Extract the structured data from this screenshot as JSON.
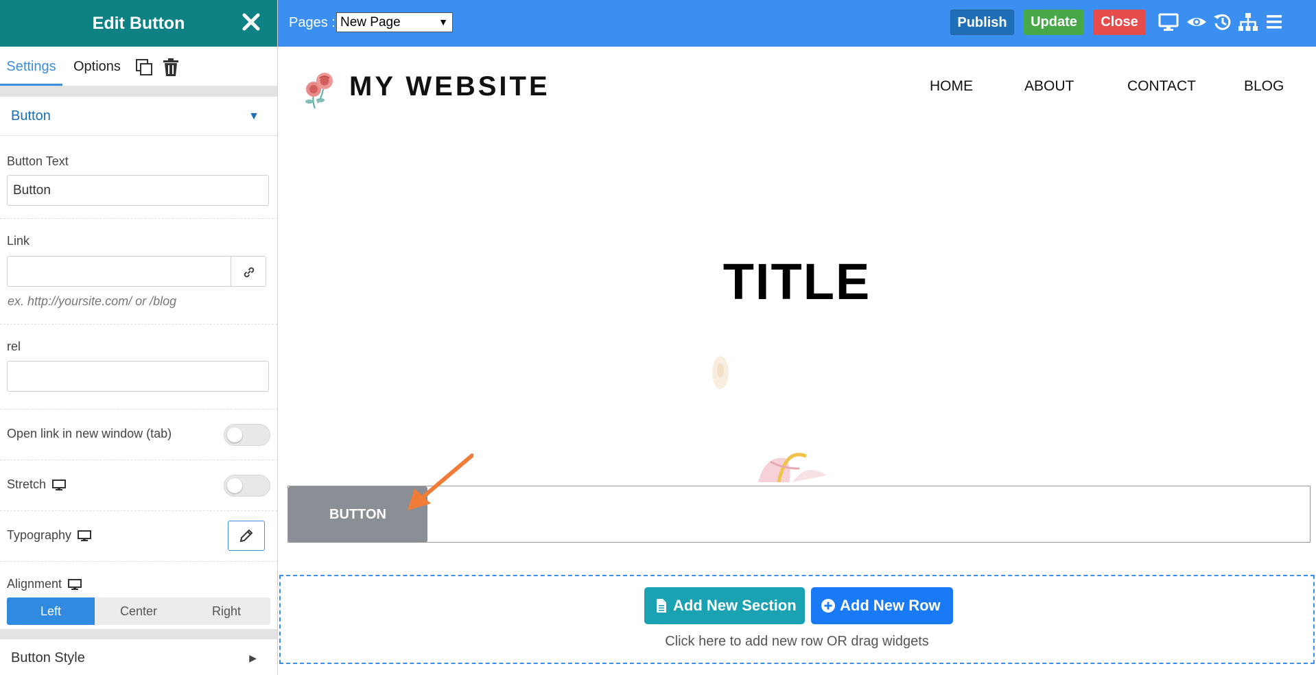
{
  "panel": {
    "title": "Edit Button",
    "tabs": {
      "settings": "Settings",
      "options": "Options"
    },
    "section_title": "Button",
    "fields": {
      "button_text_label": "Button Text",
      "button_text_value": "Button",
      "link_label": "Link",
      "link_value": "",
      "link_hint": "ex. http://yoursite.com/ or /blog",
      "rel_label": "rel",
      "rel_value": "",
      "new_window_label": "Open link in new window (tab)",
      "new_window_on": false,
      "stretch_label": "Stretch",
      "stretch_on": false,
      "typography_label": "Typography",
      "alignment_label": "Alignment",
      "alignment_options": [
        "Left",
        "Center",
        "Right"
      ],
      "alignment_selected": "Left"
    },
    "button_style_label": "Button Style"
  },
  "topbar": {
    "pages_label": "Pages :",
    "pages_selected": "New Page",
    "publish": "Publish",
    "update": "Update",
    "close": "Close",
    "icons": [
      "desktop-icon",
      "eye-icon",
      "history-icon",
      "sitemap-icon",
      "hamburger-icon"
    ]
  },
  "site": {
    "name": "MY WEBSITE",
    "nav": [
      "HOME",
      "ABOUT",
      "CONTACT",
      "BLOG"
    ],
    "title": "TITLE",
    "button_label": "BUTTON",
    "add_section": "Add New Section",
    "add_row": "Add New Row",
    "add_hint": "Click here to add new row OR drag widgets"
  },
  "colors": {
    "panel_header": "#0e8185",
    "topbar": "#3b8ff0",
    "publish": "#1f6fb8",
    "update": "#46a847",
    "close": "#e74c4c",
    "add_section": "#1aa1b2",
    "add_row": "#1a7af5",
    "arrow": "#f07c38"
  }
}
